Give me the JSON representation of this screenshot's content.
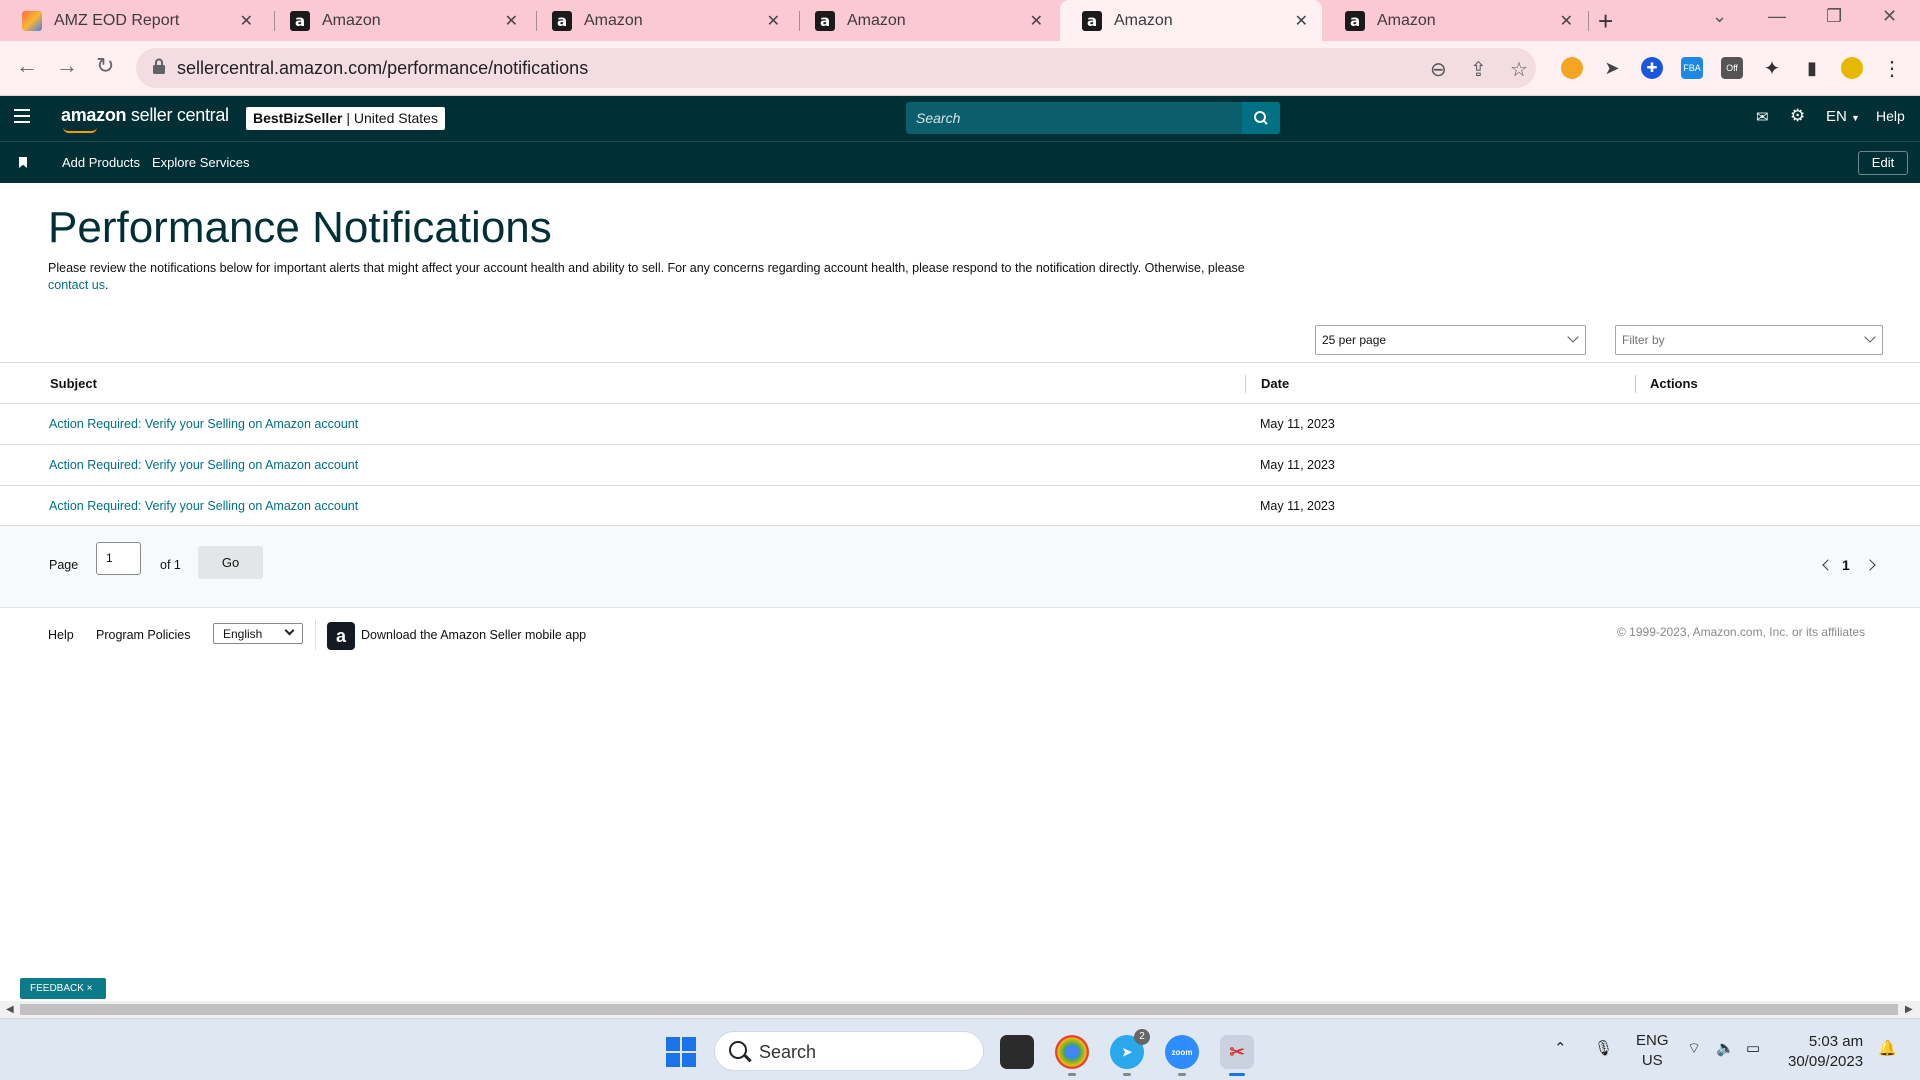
{
  "browser": {
    "tabs": [
      {
        "title": "AMZ EOD Report",
        "icon": "amz-eod-icon",
        "active": false
      },
      {
        "title": "Amazon",
        "icon": "amazon-icon",
        "active": false
      },
      {
        "title": "Amazon",
        "icon": "amazon-icon",
        "active": false
      },
      {
        "title": "Amazon",
        "icon": "amazon-icon",
        "active": false
      },
      {
        "title": "Amazon",
        "icon": "amazon-icon",
        "active": true
      },
      {
        "title": "Amazon",
        "icon": "amazon-icon",
        "active": false
      }
    ],
    "url": "sellercentral.amazon.com/performance/notifications",
    "extension_badge": "Off"
  },
  "header": {
    "logo_amazon": "amazon",
    "logo_rest": " seller central",
    "account_name": "BestBizSeller",
    "account_sep": " | ",
    "account_region": "United States",
    "search_placeholder": "Search",
    "language": "EN",
    "help": "Help"
  },
  "subnav": {
    "links": [
      "Add Products",
      "Explore Services"
    ],
    "edit": "Edit"
  },
  "main": {
    "title": "Performance Notifications",
    "intro": "Please review the notifications below for important alerts that might affect your account health and ability to sell. For any concerns regarding account health, please respond to the notification directly. Otherwise, please",
    "intro_link": "contact us",
    "intro_end": ".",
    "per_page": "25 per page",
    "filter": "Filter by",
    "columns": [
      "Subject",
      "Date",
      "Actions"
    ],
    "rows": [
      {
        "subject": "Action Required: Verify your Selling on Amazon account",
        "date": "May 11, 2023"
      },
      {
        "subject": "Action Required: Verify your Selling on Amazon account",
        "date": "May 11, 2023"
      },
      {
        "subject": "Action Required: Verify your Selling on Amazon account",
        "date": "May 11, 2023"
      }
    ],
    "pager": {
      "page_label": "Page",
      "page_value": "1",
      "of_label": "of 1",
      "go": "Go",
      "current": "1"
    }
  },
  "footer": {
    "help": "Help",
    "policies": "Program Policies",
    "language": "English",
    "app_text": "Download the Amazon Seller mobile app",
    "copyright": "© 1999-2023, Amazon.com, Inc. or its affiliates"
  },
  "feedback": "FEEDBACK ×",
  "taskbar": {
    "search": "Search",
    "telegram_badge": "2",
    "zoom_label": "zoom",
    "lang_line1": "ENG",
    "lang_line2": "US",
    "time": "5:03 am",
    "date": "30/09/2023"
  },
  "colors": {
    "header_bg": "#002f36",
    "link": "#007185",
    "tab_strip": "#fbc9d4"
  }
}
